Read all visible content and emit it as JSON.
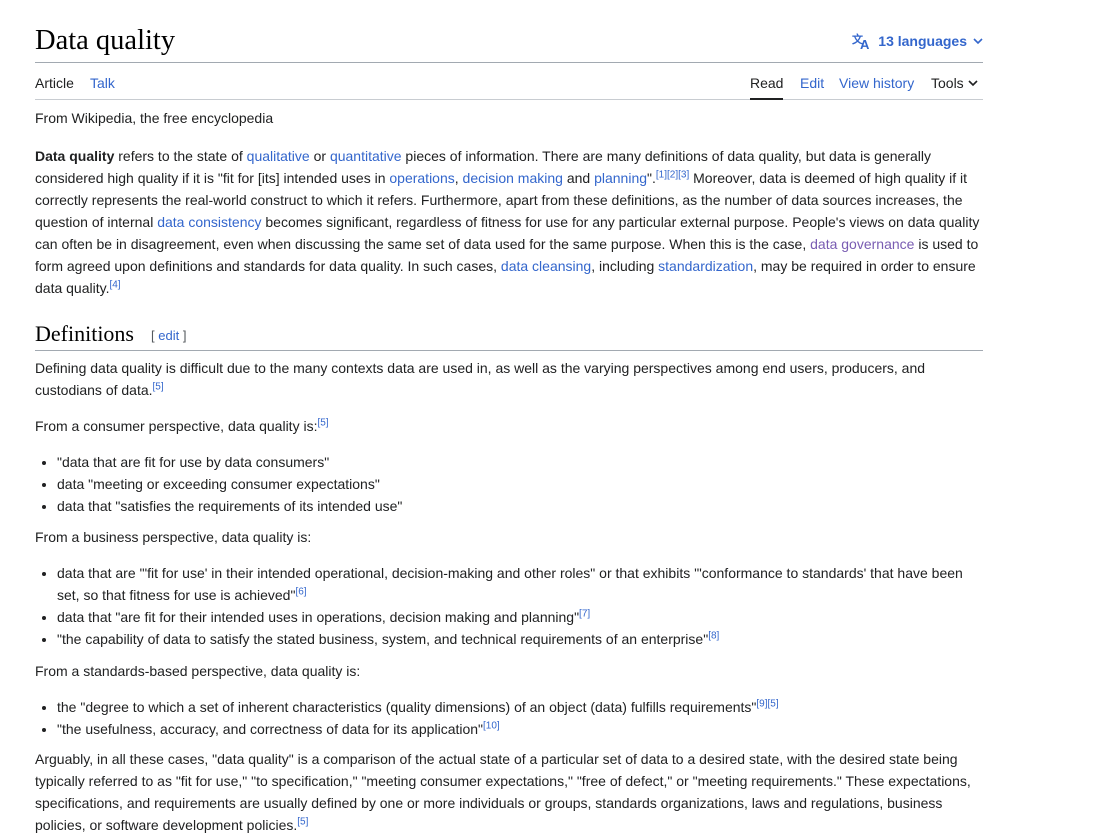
{
  "title": "Data quality",
  "languages_label": "13 languages",
  "tabs": {
    "article": "Article",
    "talk": "Talk",
    "read": "Read",
    "edit": "Edit",
    "history": "View history",
    "tools": "Tools"
  },
  "tagline": "From Wikipedia, the free encyclopedia",
  "intro": {
    "bold": "Data quality",
    "t1": " refers to the state of ",
    "l_qualitative": "qualitative",
    "t2": " or ",
    "l_quantitative": "quantitative",
    "t3": " pieces of information. There are many definitions of data quality, but data is generally considered high quality if it is \"fit for [its] intended uses in ",
    "l_operations": "operations",
    "t4": ", ",
    "l_decision": "decision making",
    "t5": " and ",
    "l_planning": "planning",
    "t6": "\".",
    "ref_123": "[1][2][3]",
    "t7": " Moreover, data is deemed of high quality if it correctly represents the real-world construct to which it refers. Furthermore, apart from these definitions, as the number of data sources increases, the question of internal ",
    "l_consistency": "data consistency",
    "t8": " becomes significant, regardless of fitness for use for any particular external purpose. People's views on data quality can often be in disagreement, even when discussing the same set of data used for the same purpose. When this is the case, ",
    "l_governance": "data governance",
    "t9": " is used to form agreed upon definitions and standards for data quality. In such cases, ",
    "l_cleansing": "data cleansing",
    "t10": ", including ",
    "l_standardization": "standardization",
    "t11": ", may be required in order to ensure data quality.",
    "ref_4": "[4]"
  },
  "definitions": {
    "heading": "Definitions",
    "edit_open": "[ ",
    "edit_label": "edit",
    "edit_close": " ]",
    "p1": "Defining data quality is difficult due to the many contexts data are used in, as well as the varying perspectives among end users, producers, and custodians of data.",
    "p1_ref": "[5]",
    "consumer_intro": "From a consumer perspective, data quality is:",
    "consumer_ref": "[5]",
    "consumer_items": [
      "\"data that are fit for use by data consumers\"",
      "data \"meeting or exceeding consumer expectations\"",
      "data that \"satisfies the requirements of its intended use\""
    ],
    "business_intro": "From a business perspective, data quality is:",
    "business_items": [
      {
        "text": "data that are '\"fit for use' in their intended operational, decision-making and other roles\" or that exhibits '\"conformance to standards' that have been set, so that fitness for use is achieved\"",
        "ref": "[6]"
      },
      {
        "text": "data that \"are fit for their intended uses in operations, decision making and planning\"",
        "ref": "[7]"
      },
      {
        "text": "\"the capability of data to satisfy the stated business, system, and technical requirements of an enterprise\"",
        "ref": "[8]"
      }
    ],
    "standards_intro": "From a standards-based perspective, data quality is:",
    "standards_items": [
      {
        "text": "the \"degree to which a set of inherent characteristics (quality dimensions) of an object (data) fulfills requirements\"",
        "ref": "[9][5]"
      },
      {
        "text": "\"the usefulness, accuracy, and correctness of data for its application\"",
        "ref": "[10]"
      }
    ],
    "closing": "Arguably, in all these cases, \"data quality\" is a comparison of the actual state of a particular set of data to a desired state, with the desired state being typically referred to as \"fit for use,\" \"to specification,\" \"meeting consumer expectations,\" \"free of defect,\" or \"meeting requirements.\" These expectations, specifications, and requirements are usually defined by one or more individuals or groups, standards organizations, laws and regulations, business policies, or software development policies.",
    "closing_ref": "[5]"
  }
}
